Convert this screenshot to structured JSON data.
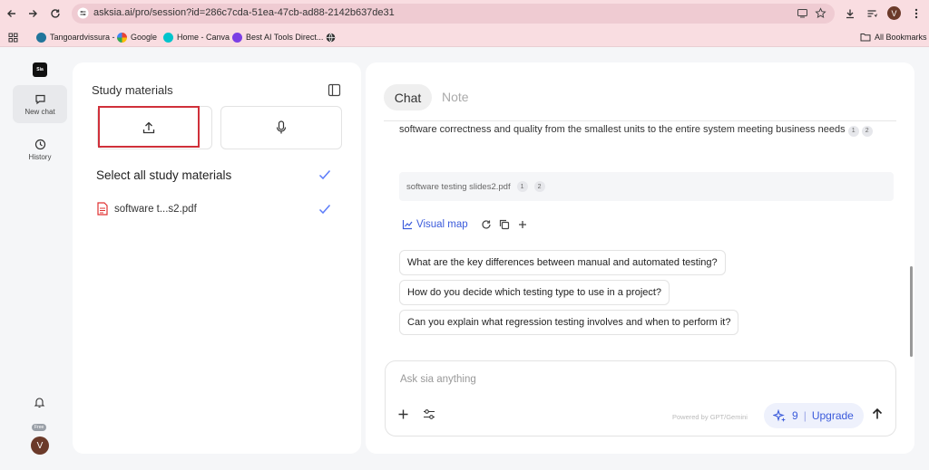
{
  "browser": {
    "url": "asksia.ai/pro/session?id=286c7cda-51ea-47cb-ad88-2142b637de31",
    "profile_initial": "V",
    "bookmarks": [
      "Tangoardvissura -",
      "Google",
      "Home - Canva",
      "Best AI Tools Direct..."
    ],
    "all_bookmarks": "All Bookmarks"
  },
  "rail": {
    "logo": "Sia",
    "new_chat": "New chat",
    "history": "History",
    "free_badge": "Free",
    "avatar_initial": "V"
  },
  "study": {
    "title": "Study materials",
    "select_all": "Select all study materials",
    "file_name": "software t...s2.pdf"
  },
  "chat": {
    "tab_chat": "Chat",
    "tab_note": "Note",
    "cut_text": "software correctness and quality from the smallest units to the entire system meeting business needs",
    "cite_1": "1",
    "cite_2": "2",
    "source_file": "software testing slides2.pdf",
    "visual_map": "Visual map",
    "suggestions": [
      "What are the key differences between manual and automated testing?",
      "How do you decide which testing type to use in a project?",
      "Can you explain what regression testing involves and when to perform it?"
    ],
    "input_placeholder": "Ask sia anything",
    "powered_by": "Powered by GPT/Gemini",
    "credits": "9",
    "upgrade": "Upgrade"
  },
  "colors": {
    "browser_bar": "#f9dde1",
    "accent": "#3b5bdb",
    "highlight_box": "#d0303a"
  }
}
